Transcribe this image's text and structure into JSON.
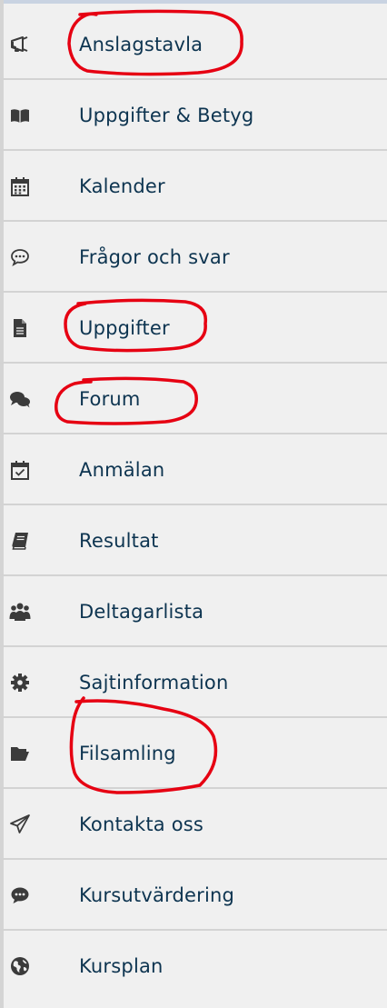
{
  "accent_color": "#e60012",
  "nav": {
    "items": [
      {
        "label": "Anslagstavla",
        "icon": "megaphone-icon",
        "circled": true
      },
      {
        "label": "Uppgifter & Betyg",
        "icon": "open-book-icon",
        "circled": false
      },
      {
        "label": "Kalender",
        "icon": "calendar-icon",
        "circled": false
      },
      {
        "label": "Frågor och svar",
        "icon": "speech-bubble-dots-icon",
        "circled": false
      },
      {
        "label": "Uppgifter",
        "icon": "document-icon",
        "circled": true
      },
      {
        "label": "Forum",
        "icon": "chat-bubbles-icon",
        "circled": true
      },
      {
        "label": "Anmälan",
        "icon": "calendar-check-icon",
        "circled": false
      },
      {
        "label": "Resultat",
        "icon": "book-icon",
        "circled": false
      },
      {
        "label": "Deltagarlista",
        "icon": "users-icon",
        "circled": false
      },
      {
        "label": "Sajtinformation",
        "icon": "gear-icon",
        "circled": false
      },
      {
        "label": "Filsamling",
        "icon": "folder-open-icon",
        "circled": true
      },
      {
        "label": "Kontakta oss",
        "icon": "paper-plane-icon",
        "circled": false
      },
      {
        "label": "Kursutvärdering",
        "icon": "comment-dots-icon",
        "circled": false
      },
      {
        "label": "Kursplan",
        "icon": "globe-icon",
        "circled": false
      }
    ]
  }
}
